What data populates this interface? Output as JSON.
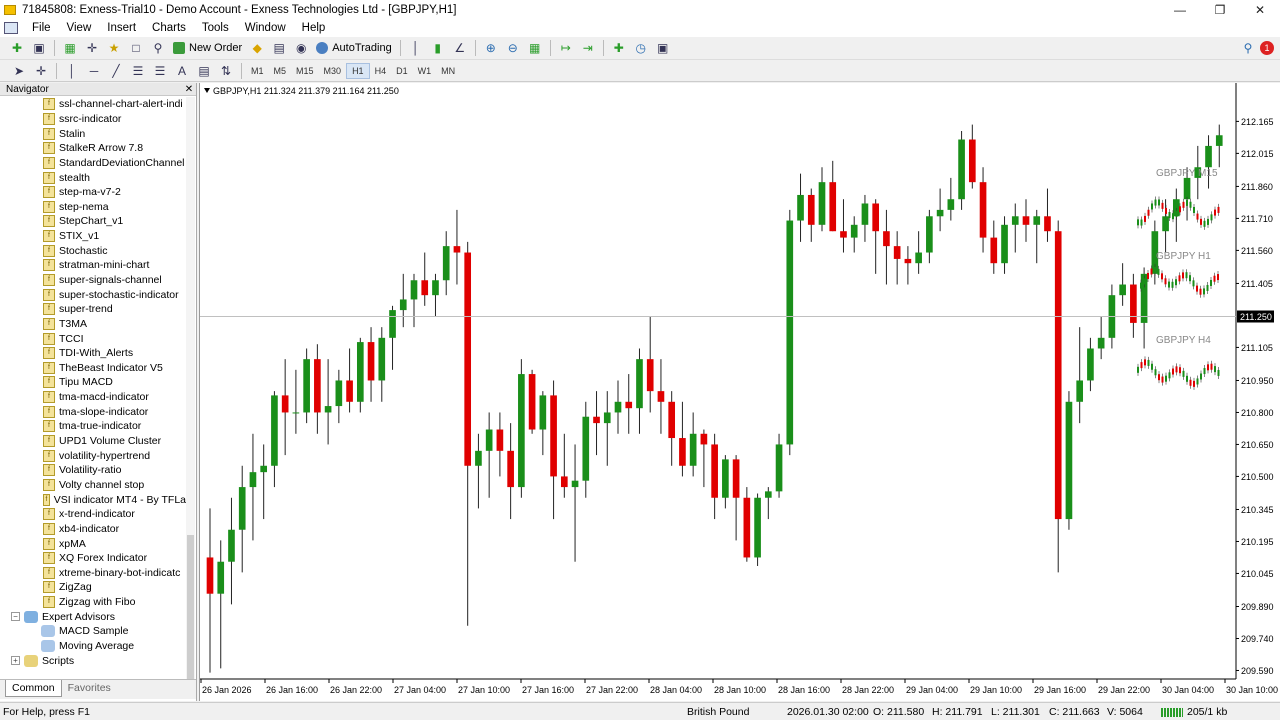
{
  "window": {
    "title": "71845808: Exness-Trial10 - Demo Account - Exness Technologies Ltd - [GBPJPY,H1]"
  },
  "menu": [
    "File",
    "View",
    "Insert",
    "Charts",
    "Tools",
    "Window",
    "Help"
  ],
  "toolbar": {
    "new_order": "New Order",
    "autotrading": "AutoTrading"
  },
  "timeframes": [
    "M1",
    "M5",
    "M15",
    "M30",
    "H1",
    "H4",
    "D1",
    "W1",
    "MN"
  ],
  "active_timeframe": "H1",
  "navigator": {
    "title": "Navigator",
    "indicators": [
      "ssl-channel-chart-alert-indi",
      "ssrc-indicator",
      "Stalin",
      "StalkeR Arrow 7.8",
      "StandardDeviationChannel",
      "stealth",
      "step-ma-v7-2",
      "step-nema",
      "StepChart_v1",
      "STIX_v1",
      "Stochastic",
      "stratman-mini-chart",
      "super-signals-channel",
      "super-stochastic-indicator",
      "super-trend",
      "T3MA",
      "TCCI",
      "TDI-With_Alerts",
      "TheBeast Indicator V5",
      "Tipu MACD",
      "tma-macd-indicator",
      "tma-slope-indicator",
      "tma-true-indicator",
      "UPD1 Volume Cluster",
      "volatility-hypertrend",
      "Volatility-ratio",
      "Volty channel stop",
      "VSI indicator MT4 - By TFLa",
      "x-trend-indicator",
      "xb4-indicator",
      "xpMA",
      "XQ Forex Indicator",
      "xtreme-binary-bot-indicatc",
      "ZigZag",
      "Zigzag with Fibo"
    ],
    "expert_advisors_label": "Expert Advisors",
    "expert_advisors": [
      "MACD Sample",
      "Moving Average"
    ],
    "scripts_label": "Scripts",
    "tabs": [
      "Common",
      "Favorites"
    ]
  },
  "chart": {
    "header": "GBPJPY,H1  211.324 211.379 211.164 211.250",
    "current_price_label": "211.250",
    "price_ticks": [
      "212.165",
      "212.015",
      "211.860",
      "211.710",
      "211.560",
      "211.405",
      "211.250",
      "211.105",
      "210.950",
      "210.800",
      "210.650",
      "210.500",
      "210.345",
      "210.195",
      "210.045",
      "209.890",
      "209.740",
      "209.590"
    ],
    "time_ticks": [
      "26 Jan 2026",
      "26 Jan 16:00",
      "26 Jan 22:00",
      "27 Jan 04:00",
      "27 Jan 10:00",
      "27 Jan 16:00",
      "27 Jan 22:00",
      "28 Jan 04:00",
      "28 Jan 10:00",
      "28 Jan 16:00",
      "28 Jan 22:00",
      "29 Jan 04:00",
      "29 Jan 10:00",
      "29 Jan 16:00",
      "29 Jan 22:00",
      "30 Jan 04:00",
      "30 Jan 10:00"
    ],
    "mini_labels": [
      "GBPJPY M15",
      "GBPJPY H1",
      "GBPJPY H4"
    ],
    "colors": {
      "bull": "#1a8f1a",
      "bear": "#e00000",
      "bg": "#ffffff",
      "price_label_bg": "#000000"
    }
  },
  "chart_data": {
    "type": "candlestick",
    "symbol": "GBPJPY",
    "timeframe": "H1",
    "ylim": [
      209.55,
      212.27
    ],
    "candles": [
      [
        210.12,
        210.35,
        209.58,
        209.95
      ],
      [
        209.95,
        210.2,
        209.6,
        210.1
      ],
      [
        210.1,
        210.4,
        209.9,
        210.25
      ],
      [
        210.25,
        210.55,
        210.05,
        210.45
      ],
      [
        210.45,
        210.7,
        210.2,
        210.52
      ],
      [
        210.52,
        210.65,
        210.3,
        210.55
      ],
      [
        210.55,
        210.9,
        210.45,
        210.88
      ],
      [
        210.88,
        211.05,
        210.6,
        210.8
      ],
      [
        210.8,
        211.0,
        210.7,
        210.8
      ],
      [
        210.8,
        211.1,
        210.75,
        211.05
      ],
      [
        211.05,
        211.12,
        210.7,
        210.8
      ],
      [
        210.8,
        211.05,
        210.65,
        210.83
      ],
      [
        210.83,
        211.0,
        210.75,
        210.95
      ],
      [
        210.95,
        211.1,
        210.8,
        210.85
      ],
      [
        210.85,
        211.15,
        210.8,
        211.13
      ],
      [
        211.13,
        211.2,
        210.85,
        210.95
      ],
      [
        210.95,
        211.2,
        210.85,
        211.15
      ],
      [
        211.15,
        211.3,
        211.0,
        211.28
      ],
      [
        211.28,
        211.45,
        211.2,
        211.33
      ],
      [
        211.33,
        211.45,
        211.2,
        211.42
      ],
      [
        211.42,
        211.55,
        211.3,
        211.35
      ],
      [
        211.35,
        211.45,
        211.25,
        211.42
      ],
      [
        211.42,
        211.65,
        211.35,
        211.58
      ],
      [
        211.58,
        211.75,
        211.4,
        211.55
      ],
      [
        211.55,
        211.6,
        209.8,
        210.55
      ],
      [
        210.55,
        210.7,
        210.35,
        210.62
      ],
      [
        210.62,
        210.8,
        210.4,
        210.72
      ],
      [
        210.72,
        210.8,
        210.5,
        210.62
      ],
      [
        210.62,
        210.75,
        210.3,
        210.45
      ],
      [
        210.45,
        211.05,
        210.4,
        210.98
      ],
      [
        210.98,
        211.0,
        210.7,
        210.72
      ],
      [
        210.72,
        210.9,
        210.6,
        210.88
      ],
      [
        210.88,
        210.95,
        210.3,
        210.5
      ],
      [
        210.5,
        210.7,
        210.4,
        210.45
      ],
      [
        210.45,
        210.65,
        210.1,
        210.48
      ],
      [
        210.48,
        210.85,
        210.4,
        210.78
      ],
      [
        210.78,
        210.9,
        210.6,
        210.75
      ],
      [
        210.75,
        210.9,
        210.55,
        210.8
      ],
      [
        210.8,
        210.95,
        210.7,
        210.85
      ],
      [
        210.85,
        210.98,
        210.7,
        210.82
      ],
      [
        210.82,
        211.1,
        210.7,
        211.05
      ],
      [
        211.05,
        211.25,
        210.8,
        210.9
      ],
      [
        210.9,
        211.05,
        210.7,
        210.85
      ],
      [
        210.85,
        210.9,
        210.55,
        210.68
      ],
      [
        210.68,
        210.85,
        210.5,
        210.55
      ],
      [
        210.55,
        210.8,
        210.5,
        210.7
      ],
      [
        210.7,
        210.72,
        210.45,
        210.65
      ],
      [
        210.65,
        210.7,
        210.3,
        210.4
      ],
      [
        210.4,
        210.6,
        210.35,
        210.58
      ],
      [
        210.58,
        210.6,
        210.2,
        210.4
      ],
      [
        210.4,
        210.45,
        210.1,
        210.12
      ],
      [
        210.12,
        210.42,
        210.08,
        210.4
      ],
      [
        210.4,
        210.45,
        210.3,
        210.43
      ],
      [
        210.43,
        210.7,
        210.4,
        210.65
      ],
      [
        210.65,
        211.75,
        210.6,
        211.7
      ],
      [
        211.7,
        211.92,
        211.6,
        211.82
      ],
      [
        211.82,
        211.85,
        211.6,
        211.68
      ],
      [
        211.68,
        211.95,
        211.65,
        211.88
      ],
      [
        211.88,
        211.98,
        211.65,
        211.65
      ],
      [
        211.65,
        211.8,
        211.55,
        211.62
      ],
      [
        211.62,
        211.72,
        211.55,
        211.68
      ],
      [
        211.68,
        211.82,
        211.6,
        211.78
      ],
      [
        211.78,
        211.8,
        211.45,
        211.65
      ],
      [
        211.65,
        211.75,
        211.4,
        211.58
      ],
      [
        211.58,
        211.65,
        211.4,
        211.52
      ],
      [
        211.52,
        211.58,
        211.4,
        211.5
      ],
      [
        211.5,
        211.65,
        211.45,
        211.55
      ],
      [
        211.55,
        211.75,
        211.5,
        211.72
      ],
      [
        211.72,
        211.85,
        211.65,
        211.75
      ],
      [
        211.75,
        211.9,
        211.7,
        211.8
      ],
      [
        211.8,
        212.12,
        211.75,
        212.08
      ],
      [
        212.08,
        212.15,
        211.85,
        211.88
      ],
      [
        211.88,
        211.95,
        211.55,
        211.62
      ],
      [
        211.62,
        211.7,
        211.45,
        211.5
      ],
      [
        211.5,
        211.72,
        211.45,
        211.68
      ],
      [
        211.68,
        211.78,
        211.55,
        211.72
      ],
      [
        211.72,
        211.8,
        211.6,
        211.68
      ],
      [
        211.68,
        211.75,
        211.5,
        211.72
      ],
      [
        211.72,
        211.85,
        211.6,
        211.65
      ],
      [
        211.65,
        211.7,
        210.05,
        210.3
      ],
      [
        210.3,
        210.9,
        210.25,
        210.85
      ],
      [
        210.85,
        211.2,
        210.75,
        210.95
      ],
      [
        210.95,
        211.15,
        210.9,
        211.1
      ],
      [
        211.1,
        211.25,
        211.05,
        211.15
      ],
      [
        211.15,
        211.4,
        211.1,
        211.35
      ],
      [
        211.35,
        211.5,
        211.3,
        211.4
      ],
      [
        211.4,
        211.45,
        211.15,
        211.22
      ],
      [
        211.22,
        211.48,
        211.1,
        211.45
      ],
      [
        211.45,
        211.7,
        211.4,
        211.65
      ],
      [
        211.65,
        211.8,
        211.55,
        211.72
      ],
      [
        211.72,
        211.85,
        211.6,
        211.8
      ],
      [
        211.8,
        211.95,
        211.7,
        211.9
      ],
      [
        211.9,
        212.05,
        211.8,
        211.95
      ],
      [
        211.95,
        212.1,
        211.85,
        212.05
      ],
      [
        212.05,
        212.15,
        211.95,
        212.1
      ]
    ]
  },
  "status": {
    "help": "For Help, press F1",
    "profile": "British Pound",
    "datetime": "2026.01.30 02:00",
    "open": "O: 211.580",
    "high": "H: 211.791",
    "low": "L: 211.301",
    "close": "C: 211.663",
    "volume": "V: 5064",
    "traffic": "205/1 kb"
  }
}
